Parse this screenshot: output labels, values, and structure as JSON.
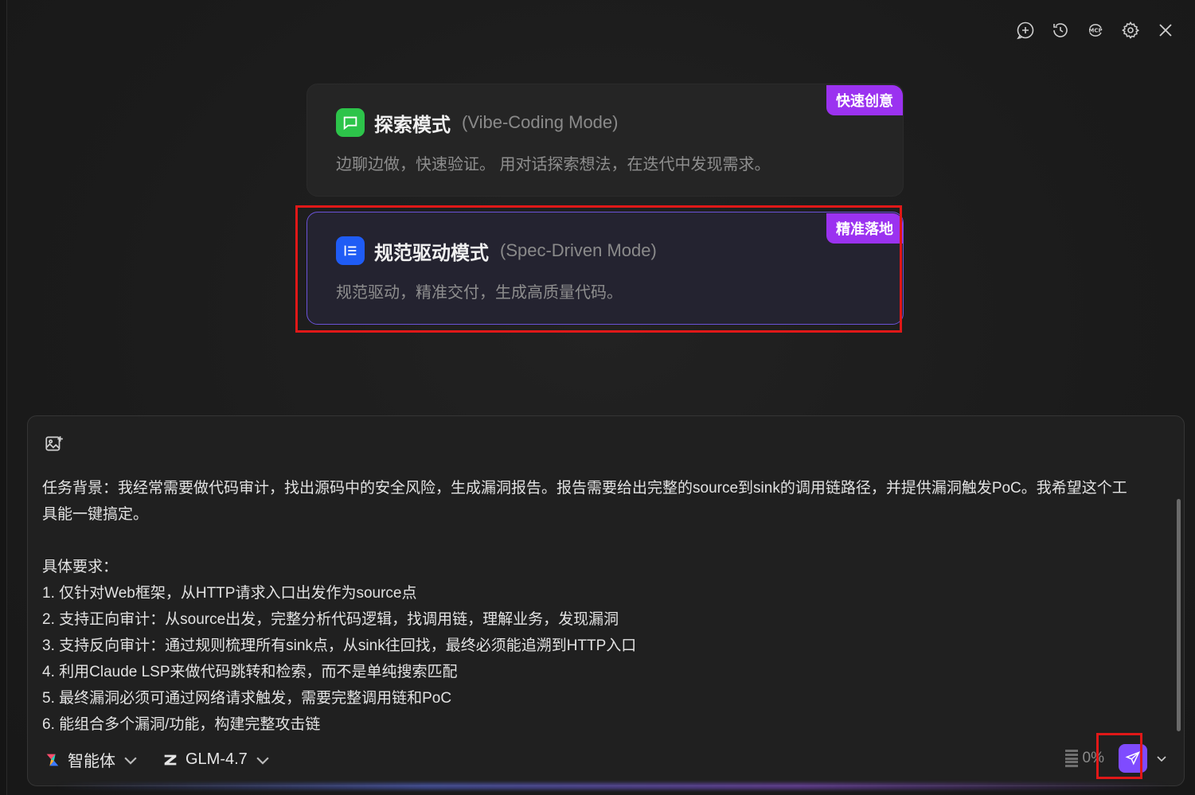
{
  "toolbar": {
    "icons": [
      "new-chat-icon",
      "history-icon",
      "mcp-icon",
      "gear-icon",
      "close-icon"
    ],
    "mcp_label": "MCP"
  },
  "modes": [
    {
      "title": "探索模式",
      "subtitle": "(Vibe-Coding Mode)",
      "description": "边聊边做，快速验证。 用对话探索想法，在迭代中发现需求。",
      "badge": "快速创意",
      "icon": "chat-bubble-icon",
      "icon_color": "#2dc44a"
    },
    {
      "title": "规范驱动模式",
      "subtitle": "(Spec-Driven Mode)",
      "description": "规范驱动，精准交付，生成高质量代码。",
      "badge": "精准落地",
      "icon": "list-icon",
      "icon_color": "#1f5cf5",
      "selected": true
    }
  ],
  "composer": {
    "prompt_lines": [
      "任务背景：我经常需要做代码审计，找出源码中的安全风险，生成漏洞报告。报告需要给出完整的source到sink的调用链路径，并提供漏洞触发PoC。我希望这个工",
      "具能一键搞定。",
      "",
      "具体要求：",
      "1. 仅针对Web框架，从HTTP请求入口出发作为source点",
      "2. 支持正向审计：从source出发，完整分析代码逻辑，找调用链，理解业务，发现漏洞",
      "3. 支持反向审计：通过规则梳理所有sink点，从sink往回找，最终必须能追溯到HTTP入口",
      "4. 利用Claude LSP来做代码跳转和检索，而不是单纯搜索匹配",
      "5. 最终漏洞必须可通过网络请求触发，需要完整调用链和PoC",
      "6. 能组合多个漏洞/功能，构建完整攻击链"
    ],
    "agent_label": "智能体",
    "model_label": "GLM-4.7",
    "context_usage": "0%"
  },
  "colors": {
    "accent": "#7f4bff",
    "badge": "#9b32f0",
    "highlight": "#e01818"
  }
}
